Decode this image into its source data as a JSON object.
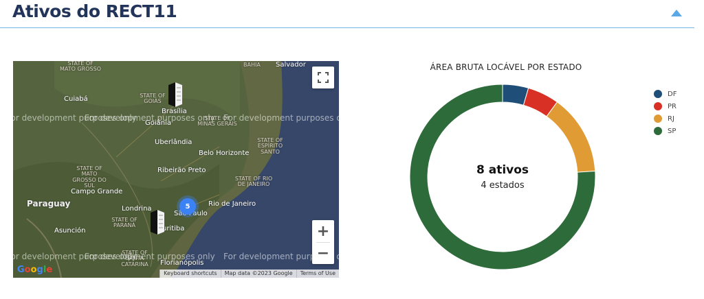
{
  "header": {
    "title": "Ativos do RECT11"
  },
  "map": {
    "watermark": "For development purposes only",
    "states": [
      "STATE OF GOIÁS",
      "STATE OF MINAS GERAIS",
      "STATE OF ESPÍRITO SANTO",
      "STATE OF MATO GROSSO DO SUL",
      "STATE OF RIO DE JANEIRO",
      "STATE OF PARANÁ",
      "STATE OF SANTA CATARINA",
      "STATE OF MATO GROSSO",
      "BAHIA"
    ],
    "cities": [
      "Salvador",
      "Cuiabá",
      "Brasília",
      "Goiânia",
      "Uberlândia",
      "Belo Horizonte",
      "Ribeirão Preto",
      "Campo Grande",
      "Rio de Janeiro",
      "São Paulo",
      "Londrina",
      "Curitiba",
      "Florianópolis",
      "Asunción",
      "Paraguay"
    ],
    "cluster_count": "5",
    "attribution": [
      "Keyboard shortcuts",
      "Map data ©2023 Google",
      "Terms of Use"
    ],
    "logo": "Google",
    "zoom_in": "+",
    "zoom_out": "−"
  },
  "chart_data": {
    "type": "pie",
    "title": "ÁREA BRUTA LOCÁVEL POR ESTADO",
    "categories": [
      "DF",
      "PR",
      "RJ",
      "SP"
    ],
    "values": [
      4.5,
      5.5,
      14,
      76
    ],
    "colors": [
      "#1f4e79",
      "#d93025",
      "#e09b35",
      "#2e6b3b"
    ],
    "center_title": "8 ativos",
    "center_subtitle": "4 estados",
    "legend_position": "right"
  }
}
